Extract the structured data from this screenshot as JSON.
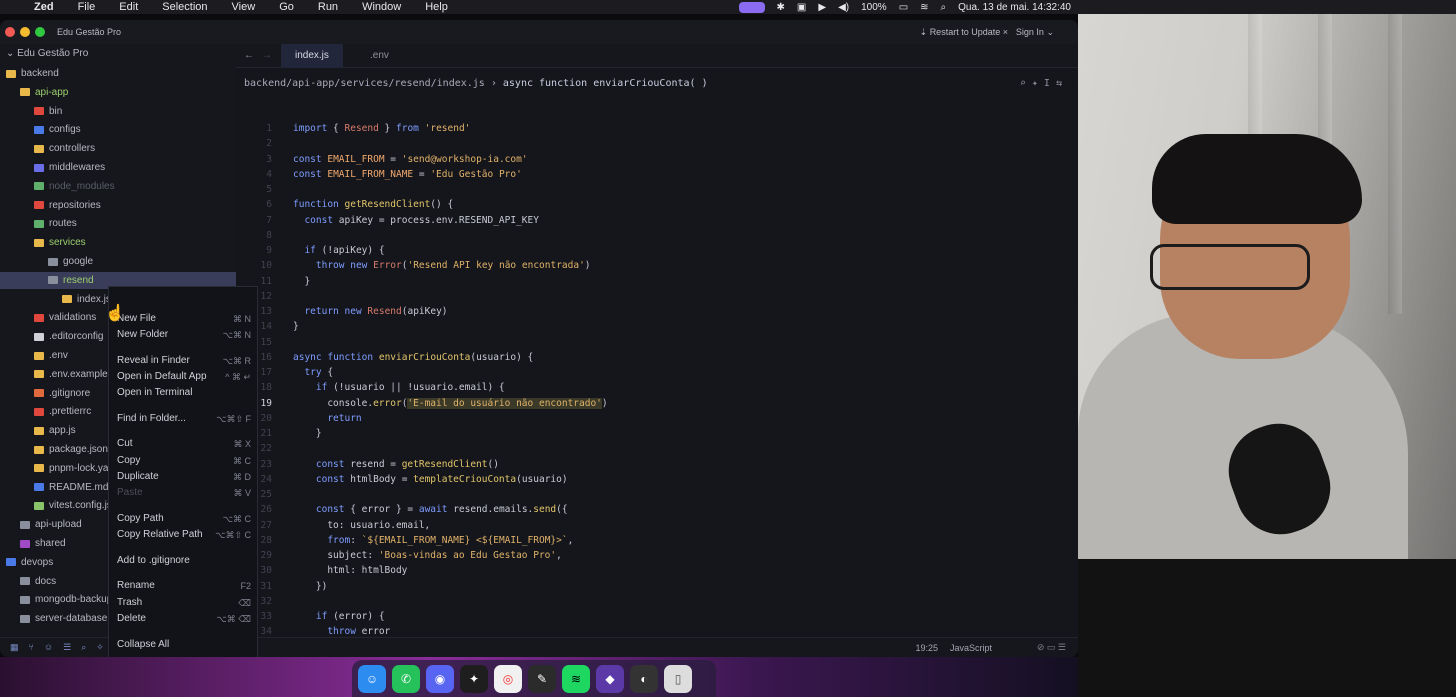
{
  "menubar": {
    "app": "Zed",
    "items": [
      "File",
      "Edit",
      "Selection",
      "View",
      "Go",
      "Run",
      "Window",
      "Help"
    ],
    "battery": "100%",
    "clock": "Qua. 13 de mai.  14:32:40"
  },
  "window": {
    "project": "Edu Gestão Pro",
    "update": "Restart to Update",
    "signin": "Sign In"
  },
  "sidebar": {
    "root": "Edu Gestão Pro",
    "items": [
      {
        "label": "backend",
        "color": "#e8b84a"
      },
      {
        "label": "api-app",
        "color": "#e8b84a"
      },
      {
        "label": "bin",
        "color": "#e0473d"
      },
      {
        "label": "configs",
        "color": "#4a7ae8"
      },
      {
        "label": "controllers",
        "color": "#e8b84a"
      },
      {
        "label": "middlewares",
        "color": "#6a6ee8"
      },
      {
        "label": "node_modules",
        "color": "#5fb06a"
      },
      {
        "label": "repositories",
        "color": "#e0473d"
      },
      {
        "label": "routes",
        "color": "#5fb06a"
      },
      {
        "label": "services",
        "color": "#e8b84a"
      },
      {
        "label": "google",
        "color": "#8a8f9e"
      },
      {
        "label": "resend",
        "color": "#8a8f9e"
      },
      {
        "label": "index.js",
        "color": "#e8b84a"
      },
      {
        "label": "validations",
        "color": "#e0473d"
      },
      {
        "label": ".editorconfig",
        "color": "#d0d1d8"
      },
      {
        "label": ".env",
        "color": "#e8b84a"
      },
      {
        "label": ".env.example",
        "color": "#e8b84a"
      },
      {
        "label": ".gitignore",
        "color": "#e06a3d"
      },
      {
        "label": ".prettierrc",
        "color": "#e0473d"
      },
      {
        "label": "app.js",
        "color": "#e8b84a"
      },
      {
        "label": "package.json",
        "color": "#e8b84a"
      },
      {
        "label": "pnpm-lock.yaml",
        "color": "#e8b84a"
      },
      {
        "label": "README.md",
        "color": "#4a7ae8"
      },
      {
        "label": "vitest.config.js",
        "color": "#8ac46a"
      },
      {
        "label": "api-upload",
        "color": "#8a8f9e"
      },
      {
        "label": "shared",
        "color": "#a04ac8"
      },
      {
        "label": "devops",
        "color": "#4a7ae8"
      },
      {
        "label": "docs",
        "color": "#8a8f9e"
      },
      {
        "label": "mongodb-backup",
        "color": "#8a8f9e"
      },
      {
        "label": "server-database",
        "color": "#8a8f9e"
      }
    ]
  },
  "context_menu": {
    "items": [
      {
        "label": "New File",
        "kbd": "⌘ N"
      },
      {
        "label": "New Folder",
        "kbd": "⌥⌘ N"
      },
      {
        "label": "Reveal in Finder",
        "kbd": "⌥⌘ R"
      },
      {
        "label": "Open in Default App",
        "kbd": "^ ⌘ ↵"
      },
      {
        "label": "Open in Terminal",
        "kbd": ""
      },
      {
        "label": "Find in Folder...",
        "kbd": "⌥⌘⇧ F"
      },
      {
        "label": "Cut",
        "kbd": "⌘ X"
      },
      {
        "label": "Copy",
        "kbd": "⌘ C"
      },
      {
        "label": "Duplicate",
        "kbd": "⌘ D"
      },
      {
        "label": "Paste",
        "kbd": "⌘ V"
      },
      {
        "label": "Copy Path",
        "kbd": "⌥⌘ C"
      },
      {
        "label": "Copy Relative Path",
        "kbd": "⌥⌘⇧ C"
      },
      {
        "label": "Add to .gitignore",
        "kbd": ""
      },
      {
        "label": "Rename",
        "kbd": "F2"
      },
      {
        "label": "Trash",
        "kbd": "⌫"
      },
      {
        "label": "Delete",
        "kbd": "⌥⌘ ⌫"
      },
      {
        "label": "Collapse All",
        "kbd": ""
      }
    ]
  },
  "tabs": [
    "index.js",
    ".env"
  ],
  "breadcrumb": {
    "path": "backend/api-app/services/resend/index.js",
    "symbol": "async function enviarCriouConta( )"
  },
  "editor": {
    "current_line": "19",
    "lines": [
      "import { Resend } from 'resend'",
      "",
      "const EMAIL_FROM = 'send@workshop-ia.com'",
      "const EMAIL_FROM_NAME = 'Edu Gestão Pro'",
      "",
      "function getResendClient() {",
      "  const apiKey = process.env.RESEND_API_KEY",
      "",
      "  if (!apiKey) {",
      "    throw new Error('Resend API key não encontrada')",
      "  }",
      "",
      "  return new Resend(apiKey)",
      "}",
      "",
      "async function enviarCriouConta(usuario) {",
      "  try {",
      "    if (!usuario || !usuario.email) {",
      "      console.error('E-mail do usuário não encontrado')",
      "      return",
      "    }",
      "",
      "    const resend = getResendClient()",
      "    const htmlBody = templateCriouConta(usuario)",
      "",
      "    const { error } = await resend.emails.send({",
      "      to: usuario.email,",
      "      from: `${EMAIL_FROM_NAME} <${EMAIL_FROM}>`,",
      "      subject: 'Boas-vindas ao Edu Gestao Pro',",
      "      html: htmlBody",
      "    })",
      "",
      "    if (error) {",
      "      throw error",
      "    }"
    ]
  },
  "statusbar": {
    "position": "19:25",
    "language": "JavaScript"
  }
}
